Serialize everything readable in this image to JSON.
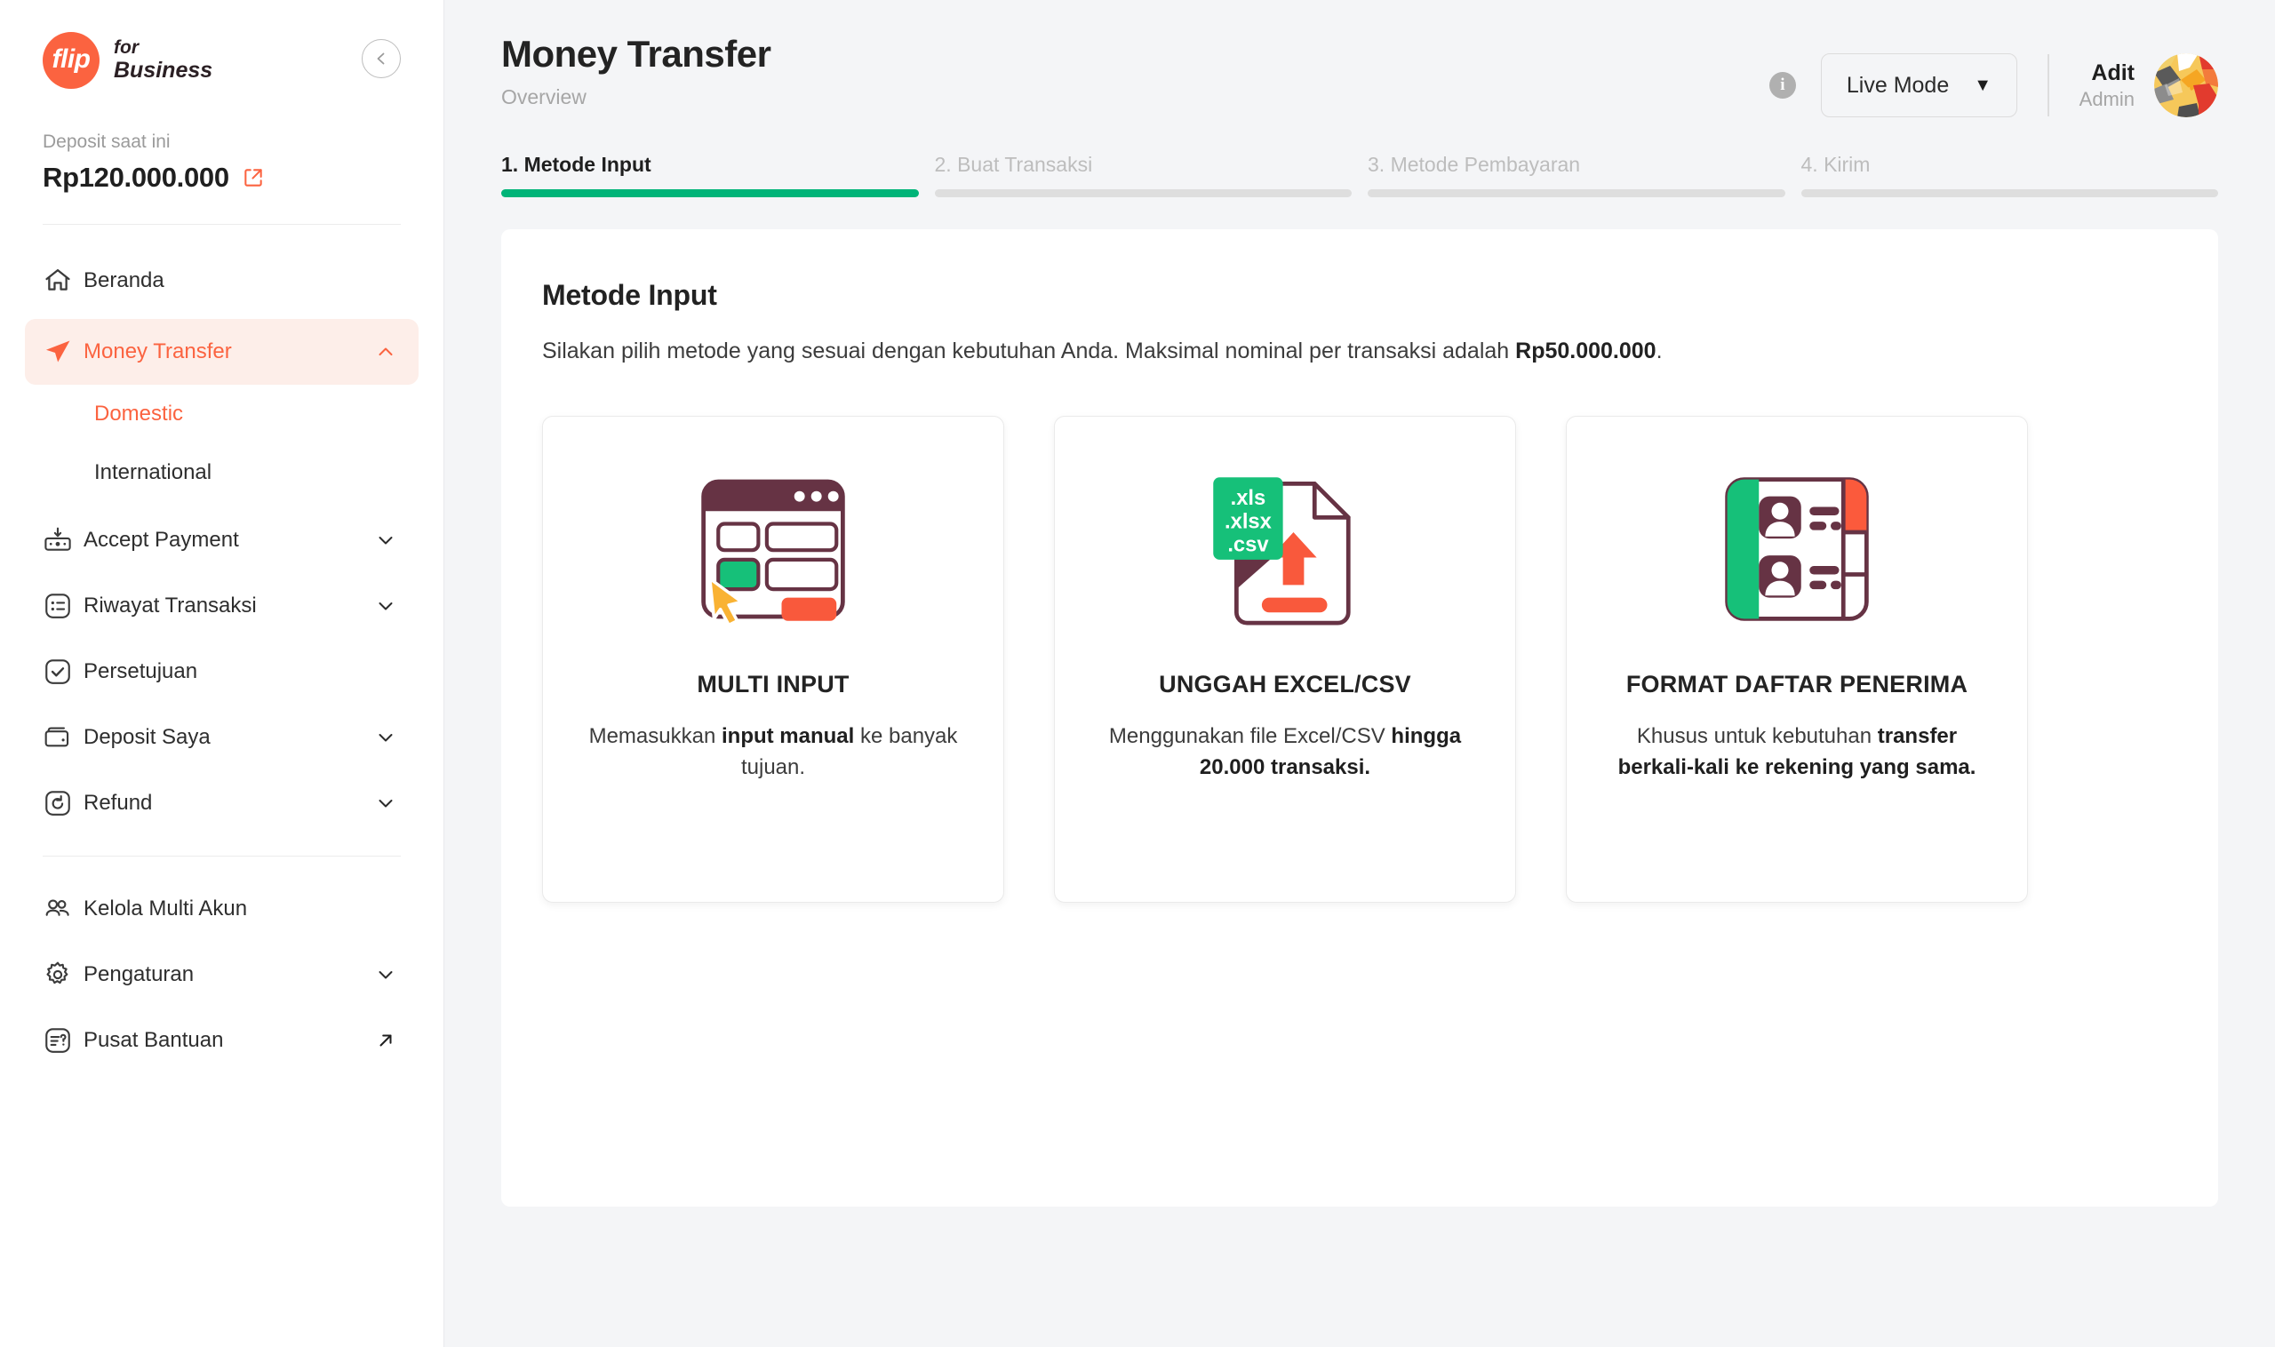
{
  "brand": {
    "mark_text": "flip",
    "line1": "for",
    "line2": "Business"
  },
  "sidebar": {
    "collapse_icon": "chevron-left-icon",
    "deposit_label": "Deposit saat ini",
    "deposit_value": "Rp120.000.000",
    "deposit_link_icon": "external-link-icon",
    "items": [
      {
        "label": "Beranda",
        "icon": "home-icon",
        "expandable": false,
        "active": false
      },
      {
        "label": "Money Transfer",
        "icon": "send-icon",
        "expandable": true,
        "active": true,
        "chevron": "chevron-up-icon"
      },
      {
        "label": "Accept Payment",
        "icon": "accept-payment-icon",
        "expandable": true,
        "active": false,
        "chevron": "chevron-down-icon"
      },
      {
        "label": "Riwayat Transaksi",
        "icon": "list-icon",
        "expandable": true,
        "active": false,
        "chevron": "chevron-down-icon"
      },
      {
        "label": "Persetujuan",
        "icon": "check-square-icon",
        "expandable": false,
        "active": false
      },
      {
        "label": "Deposit Saya",
        "icon": "wallet-icon",
        "expandable": true,
        "active": false,
        "chevron": "chevron-down-icon"
      },
      {
        "label": "Refund",
        "icon": "refund-icon",
        "expandable": true,
        "active": false,
        "chevron": "chevron-down-icon"
      }
    ],
    "sub_items": [
      {
        "label": "Domestic",
        "active": true
      },
      {
        "label": "International",
        "active": false
      }
    ],
    "bottom_items": [
      {
        "label": "Kelola Multi Akun",
        "icon": "users-icon",
        "expandable": false
      },
      {
        "label": "Pengaturan",
        "icon": "gear-icon",
        "expandable": true,
        "chevron": "chevron-down-icon"
      },
      {
        "label": "Pusat Bantuan",
        "icon": "help-doc-icon",
        "external": true,
        "chevron": "arrow-up-right-icon"
      }
    ]
  },
  "header": {
    "title": "Money Transfer",
    "subtitle": "Overview",
    "info_icon": "info-icon",
    "mode_label": "Live Mode",
    "mode_caret": "▼",
    "user_name": "Adit",
    "user_role": "Admin",
    "avatar_icon": "avatar"
  },
  "stepper": {
    "steps": [
      {
        "label": "1. Metode Input",
        "active": true
      },
      {
        "label": "2.  Buat Transaksi",
        "active": false
      },
      {
        "label": "3. Metode Pembayaran",
        "active": false
      },
      {
        "label": "4. Kirim",
        "active": false
      }
    ]
  },
  "panel": {
    "title": "Metode Input",
    "desc_before": "Silakan pilih metode yang sesuai dengan kebutuhan Anda. Maksimal nominal per transaksi adalah ",
    "desc_bold": "Rp50.000.000",
    "desc_after": ".",
    "cards": [
      {
        "art": "browser-multi-input-illustration",
        "title": "MULTI INPUT",
        "desc_1": "Memasukkan ",
        "desc_bold": "input manual",
        "desc_2": " ke banyak tujuan."
      },
      {
        "art": "excel-csv-upload-illustration",
        "title": "UNGGAH EXCEL/CSV",
        "desc_1": "Menggunakan file Excel/CSV ",
        "desc_bold": "hingga 20.000 transaksi.",
        "desc_2": "",
        "tag_lines": [
          ".xls",
          ".xlsx",
          ".csv"
        ]
      },
      {
        "art": "recipient-list-book-illustration",
        "title": "FORMAT DAFTAR PENERIMA",
        "desc_1": "Khusus untuk kebutuhan ",
        "desc_bold": "transfer berkali-kali ke rekening yang sama.",
        "desc_2": ""
      }
    ]
  },
  "colors": {
    "brand_orange": "#fb6340",
    "active_nav_bg": "#fdeee9",
    "step_green": "#00b478",
    "page_bg": "#f4f5f7",
    "illustration_maroon": "#663344",
    "illustration_green": "#16c079",
    "illustration_yellow": "#f9b233",
    "illustration_orange": "#f9593c"
  }
}
